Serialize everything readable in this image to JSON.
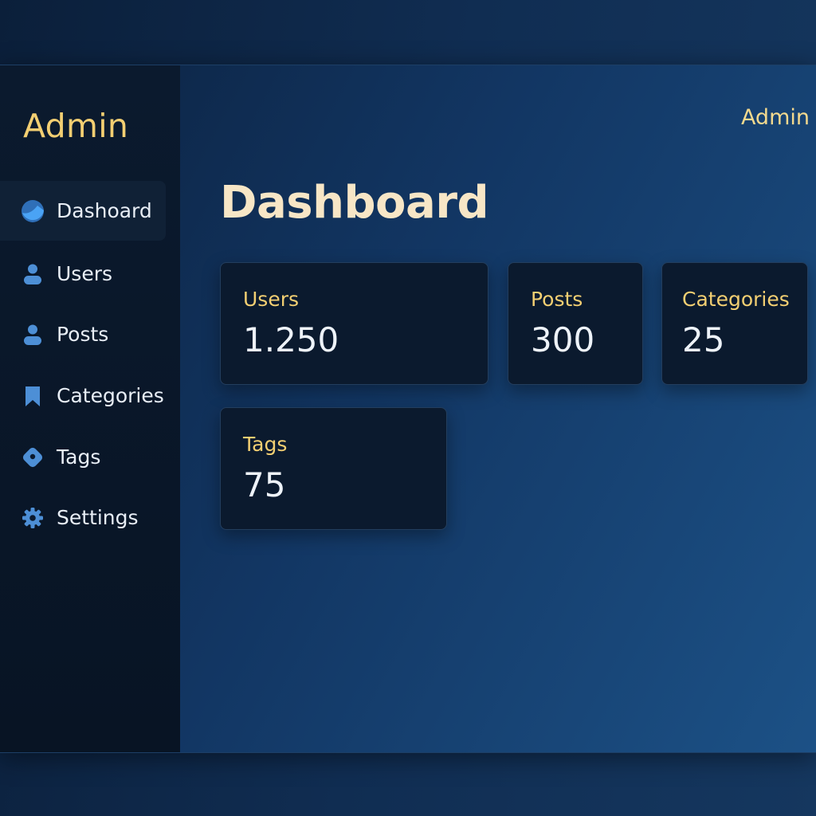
{
  "sidebar": {
    "brand": "Admin",
    "items": [
      {
        "label": "Dashoard",
        "icon": "dashboard-icon",
        "active": true
      },
      {
        "label": "Users",
        "icon": "user-icon",
        "active": false
      },
      {
        "label": "Posts",
        "icon": "user-icon",
        "active": false
      },
      {
        "label": "Categories",
        "icon": "bookmark-icon",
        "active": false
      },
      {
        "label": "Tags",
        "icon": "tag-icon",
        "active": false
      },
      {
        "label": "Settings",
        "icon": "gear-icon",
        "active": false
      }
    ]
  },
  "header": {
    "user_menu": "Admin"
  },
  "main": {
    "title": "Dashboard",
    "cards": [
      {
        "label": "Users",
        "value": "1.250"
      },
      {
        "label": "Posts",
        "value": "300"
      },
      {
        "label": "Categories",
        "value": "25"
      },
      {
        "label": "Tags",
        "value": "75"
      }
    ]
  },
  "colors": {
    "accent_gold": "#f3cf72",
    "icon_blue": "#4d8fd6",
    "sidebar_bg": "#0b1a2e",
    "card_bg": "#0b1a2e",
    "title_cream": "#f7e6c6"
  }
}
